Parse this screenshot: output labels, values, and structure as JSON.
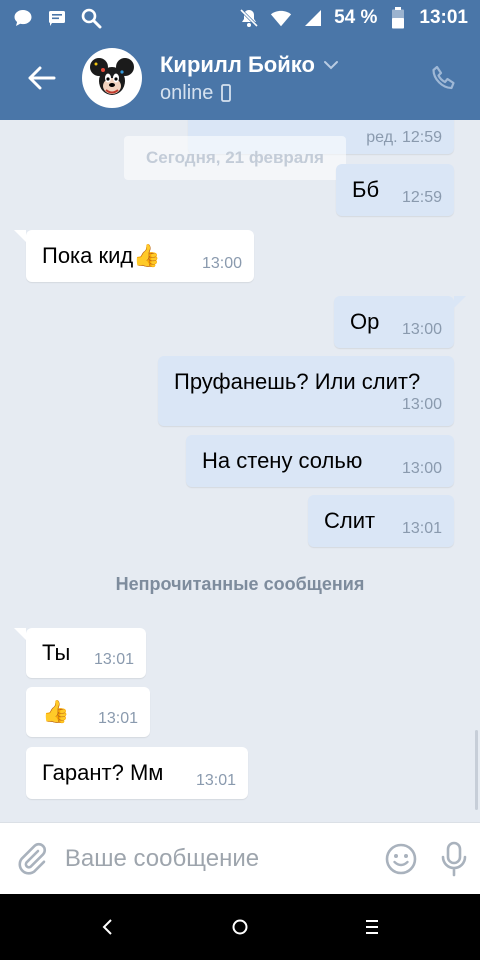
{
  "status_bar": {
    "battery_percent": "54 %",
    "time": "13:01",
    "icons": [
      "chat-bubble-icon",
      "message-icon",
      "search-icon",
      "mute-icon",
      "wifi-icon",
      "signal-icon",
      "battery-icon"
    ]
  },
  "header": {
    "contact_name": "Кирилл Бойко",
    "status": "online",
    "colors": {
      "bar": "#4a76a8"
    }
  },
  "date_divider": "Сегодня, 21 февраля",
  "unread_label": "Непрочитанные сообщения",
  "messages": [
    {
      "id": "m0",
      "direction": "out",
      "text": "",
      "time": "ред. 12:59"
    },
    {
      "id": "m1",
      "direction": "out",
      "text": "Бб",
      "time": "12:59"
    },
    {
      "id": "m2",
      "direction": "in",
      "text": "Пока кид👍",
      "time": "13:00"
    },
    {
      "id": "m3",
      "direction": "out",
      "text": "Ор",
      "time": "13:00"
    },
    {
      "id": "m4",
      "direction": "out",
      "text": "Пруфанешь? Или слит?",
      "time": "13:00"
    },
    {
      "id": "m5",
      "direction": "out",
      "text": "На стену солью",
      "time": "13:00"
    },
    {
      "id": "m6",
      "direction": "out",
      "text": "Слит",
      "time": "13:01"
    },
    {
      "id": "m7",
      "direction": "in",
      "text": "Ты",
      "time": "13:01"
    },
    {
      "id": "m8",
      "direction": "in",
      "text": "👍",
      "time": "13:01"
    },
    {
      "id": "m9",
      "direction": "in",
      "text": "Гарант? Мм",
      "time": "13:01"
    }
  ],
  "input": {
    "placeholder": "Ваше сообщение",
    "value": ""
  },
  "nav": {
    "icons": [
      "back-nav-icon",
      "home-nav-icon",
      "recents-nav-icon"
    ]
  }
}
